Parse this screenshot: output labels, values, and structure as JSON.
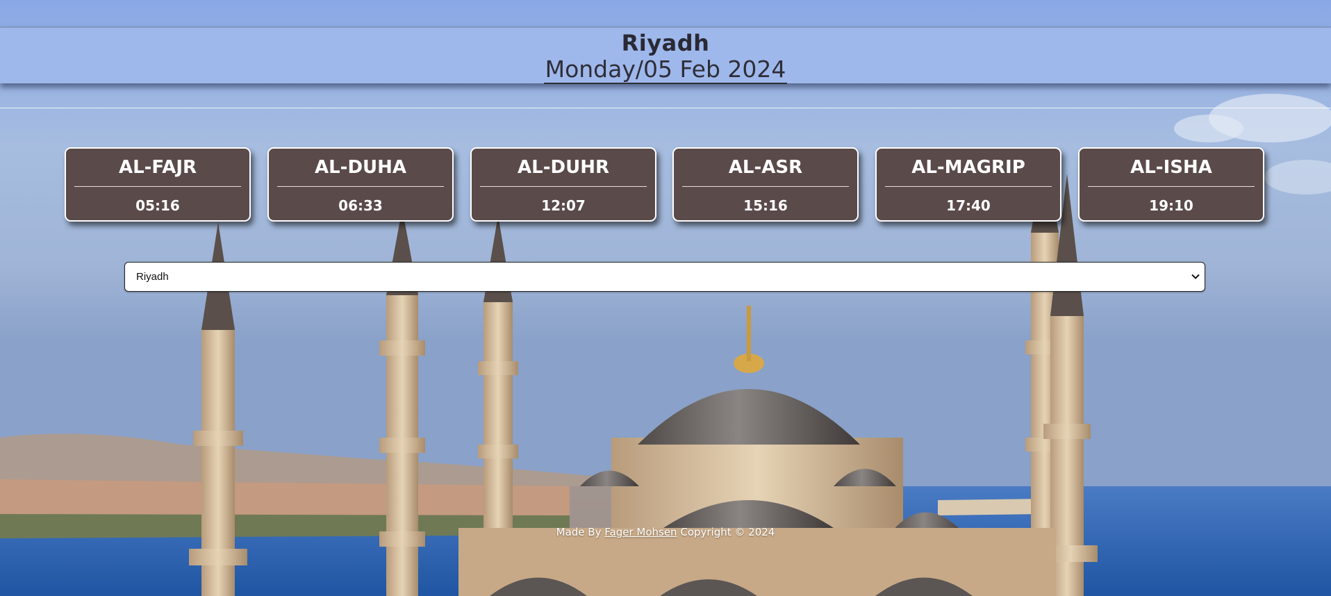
{
  "header": {
    "city": "Riyadh",
    "date": "Monday/05 Feb 2024"
  },
  "prayers": [
    {
      "name": "AL-FAJR",
      "time": "05:16"
    },
    {
      "name": "AL-DUHA",
      "time": "06:33"
    },
    {
      "name": "AL-DUHR",
      "time": "12:07"
    },
    {
      "name": "AL-ASR",
      "time": "15:16"
    },
    {
      "name": "AL-MAGRIP",
      "time": "17:40"
    },
    {
      "name": "AL-ISHA",
      "time": "19:10"
    }
  ],
  "city_select": {
    "selected": "Riyadh"
  },
  "footer": {
    "prefix": "Made By",
    "author": "Fager Mohsen",
    "suffix": "Copyright © 2024"
  },
  "colors": {
    "card_bg": "#5a4a4a",
    "header_bg": "#a0b9ec"
  }
}
